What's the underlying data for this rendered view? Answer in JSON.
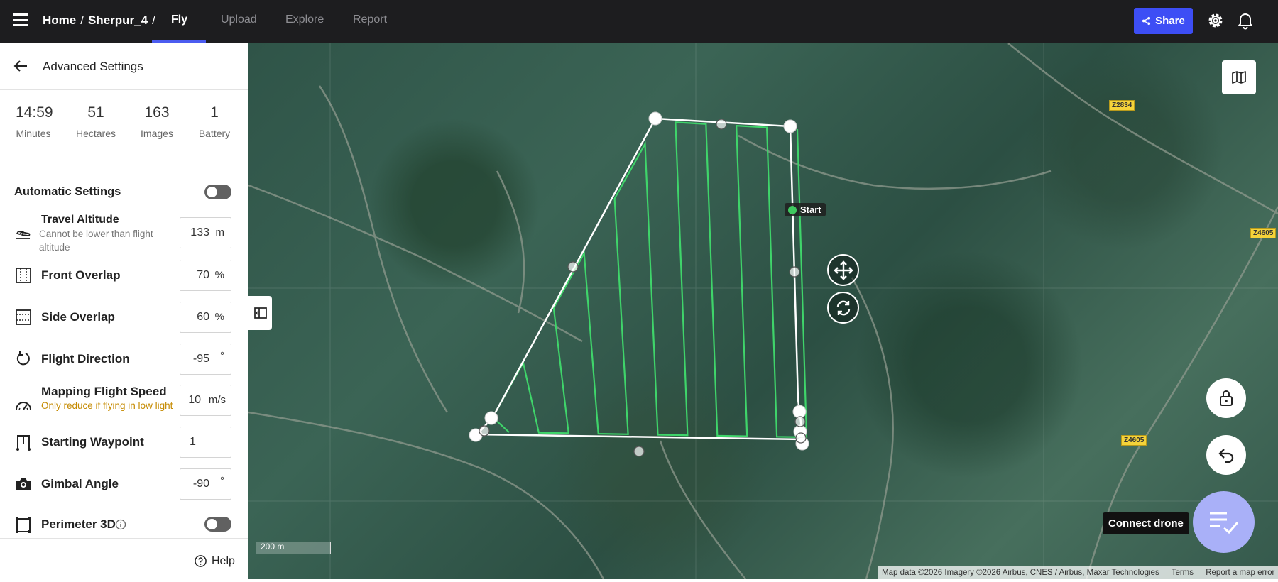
{
  "topbar": {
    "breadcrumb": [
      "Home",
      "Sherpur_4"
    ],
    "tabs": [
      {
        "label": "Fly",
        "active": true
      },
      {
        "label": "Upload",
        "active": false
      },
      {
        "label": "Explore",
        "active": false
      },
      {
        "label": "Report",
        "active": false
      }
    ],
    "share_label": "Share",
    "icons": [
      "hamburger-icon",
      "settings-gear-icon",
      "notification-bell-icon"
    ],
    "accent_color": "#3d4ef5"
  },
  "sidebar": {
    "title": "Advanced Settings",
    "stats": [
      {
        "value": "14:59",
        "label": "Minutes"
      },
      {
        "value": "51",
        "label": "Hectares"
      },
      {
        "value": "163",
        "label": "Images"
      },
      {
        "value": "1",
        "label": "Battery"
      }
    ],
    "automatic_settings": {
      "label": "Automatic Settings",
      "enabled": false
    },
    "travel_altitude": {
      "label": "Travel Altitude",
      "sub": "Cannot be lower than flight altitude",
      "value": "133",
      "unit": "m"
    },
    "front_overlap": {
      "label": "Front Overlap",
      "value": "70",
      "unit": "%"
    },
    "side_overlap": {
      "label": "Side Overlap",
      "value": "60",
      "unit": "%"
    },
    "flight_direction": {
      "label": "Flight Direction",
      "value": "-95",
      "unit": "°"
    },
    "mapping_speed": {
      "label": "Mapping Flight Speed",
      "sub": "Only reduce if flying in low light",
      "value": "10",
      "unit": "m/s"
    },
    "starting_waypoint": {
      "label": "Starting Waypoint",
      "value": "1"
    },
    "gimbal_angle": {
      "label": "Gimbal Angle",
      "value": "-90",
      "unit": "°"
    },
    "perimeter_3d": {
      "label": "Perimeter 3D",
      "enabled": false
    },
    "help_label": "Help"
  },
  "map": {
    "start_label": "Start",
    "connect_label": "Connect drone",
    "scale_label": "200 m",
    "road_labels": [
      "Z2834",
      "Z4605",
      "Z4605"
    ],
    "attribution": [
      "Map data ©2026 Imagery ©2026 Airbus, CNES / Airbus, Maxar Technologies",
      "Terms",
      "Report a map error"
    ],
    "flight_line_color": "#3fd46a",
    "connect_color": "#a9b0f8"
  }
}
